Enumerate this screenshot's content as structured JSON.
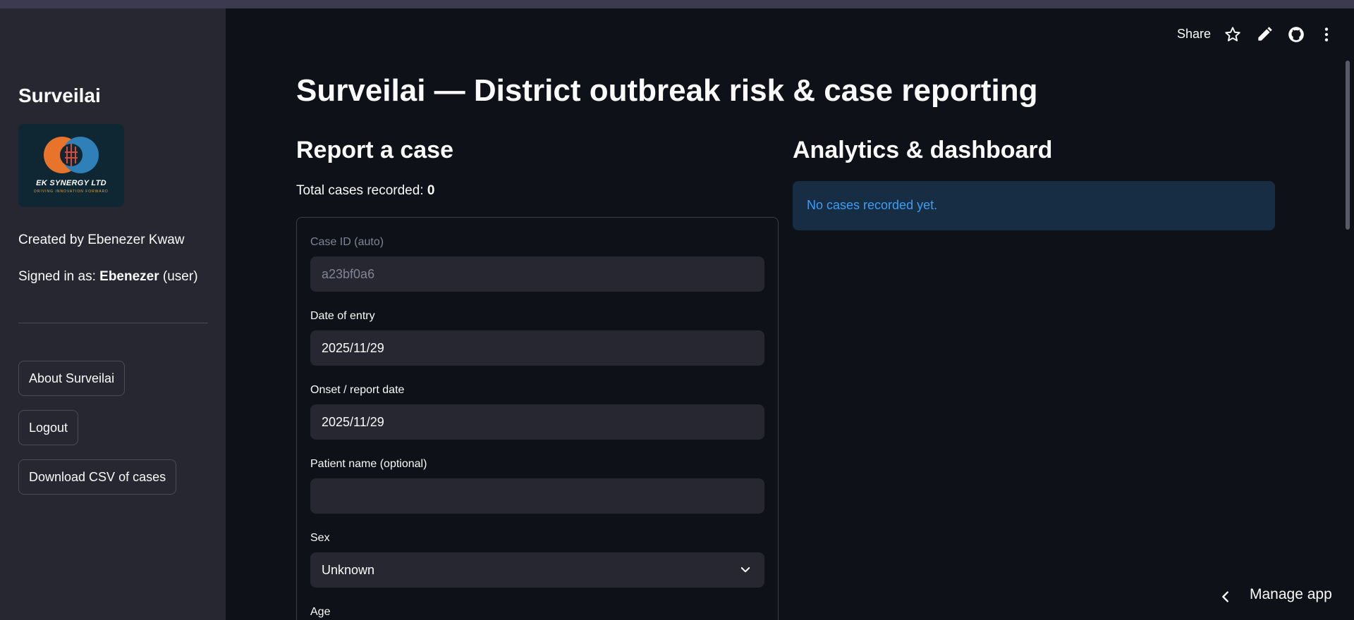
{
  "sidebar": {
    "title": "Surveilai",
    "logo": {
      "text": "EK SYNERGY LTD",
      "tagline": "DRIVING INNOVATION FORWARD"
    },
    "created_by": "Created by Ebenezer Kwaw",
    "signed_in_prefix": "Signed in as: ",
    "signed_in_user": "Ebenezer",
    "signed_in_suffix": " (user)",
    "buttons": {
      "about": "About Surveilai",
      "logout": "Logout",
      "download": "Download CSV of cases"
    }
  },
  "toolbar": {
    "share": "Share",
    "icons": [
      "star-icon",
      "edit-icon",
      "github-icon",
      "more-vert-icon"
    ]
  },
  "main": {
    "title": "Surveilai — District outbreak risk & case reporting",
    "report": {
      "heading": "Report a case",
      "total_label": "Total cases recorded: ",
      "total_value": "0",
      "fields": {
        "case_id_label": "Case ID (auto)",
        "case_id_value": "a23bf0a6",
        "date_entry_label": "Date of entry",
        "date_entry_value": "2025/11/29",
        "onset_label": "Onset / report date",
        "onset_value": "2025/11/29",
        "patient_label": "Patient name (optional)",
        "patient_value": "",
        "sex_label": "Sex",
        "sex_value": "Unknown",
        "age_label": "Age"
      }
    },
    "analytics": {
      "heading": "Analytics & dashboard",
      "info": "No cases recorded yet."
    }
  },
  "footer": {
    "manage_app": "Manage app"
  },
  "colors": {
    "background": "#0e1117",
    "sidebar": "#262730",
    "info_bg": "#172d43",
    "info_text": "#3d9df3"
  }
}
